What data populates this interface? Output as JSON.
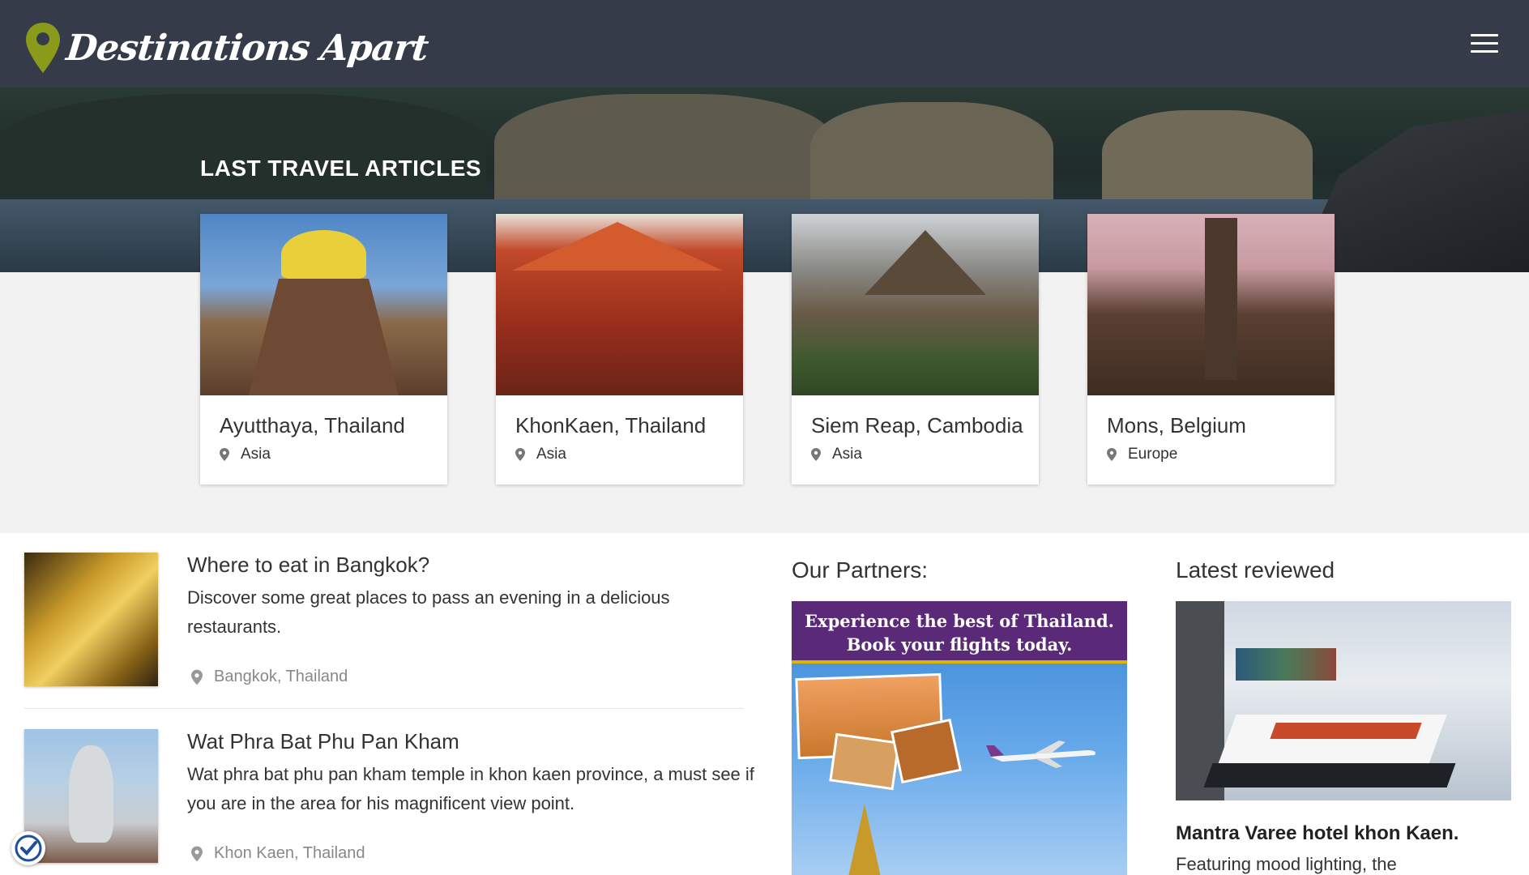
{
  "brand": {
    "name": "Destinations Apart",
    "accent": "#8a9a1a"
  },
  "nav": {
    "menu_icon": "hamburger-menu-icon"
  },
  "hero": {
    "title": "LAST TRAVEL ARTICLES"
  },
  "cards": [
    {
      "title": "Ayutthaya, Thailand",
      "region": "Asia"
    },
    {
      "title": "KhonKaen, Thailand",
      "region": "Asia"
    },
    {
      "title": "Siem Reap, Cambodia",
      "region": "Asia"
    },
    {
      "title": "Mons, Belgium",
      "region": "Europe"
    }
  ],
  "articles": [
    {
      "title": "Where to eat in Bangkok?",
      "description": "Discover some great places to pass an evening in a delicious restaurants.",
      "location": "Bangkok, Thailand"
    },
    {
      "title": "Wat Phra Bat Phu Pan Kham",
      "description": "Wat phra bat phu pan kham temple in khon kaen province, a must see if you are in the area for his magnificent view point.",
      "location": "Khon Kaen, Thailand"
    }
  ],
  "partners": {
    "title": "Our Partners:",
    "ad_line1": "Experience the best of Thailand.",
    "ad_line2": "Book your flights today."
  },
  "reviewed": {
    "title": "Latest reviewed",
    "name": "Mantra Varee hotel khon Kaen.",
    "description": "Featuring mood lighting, the"
  }
}
